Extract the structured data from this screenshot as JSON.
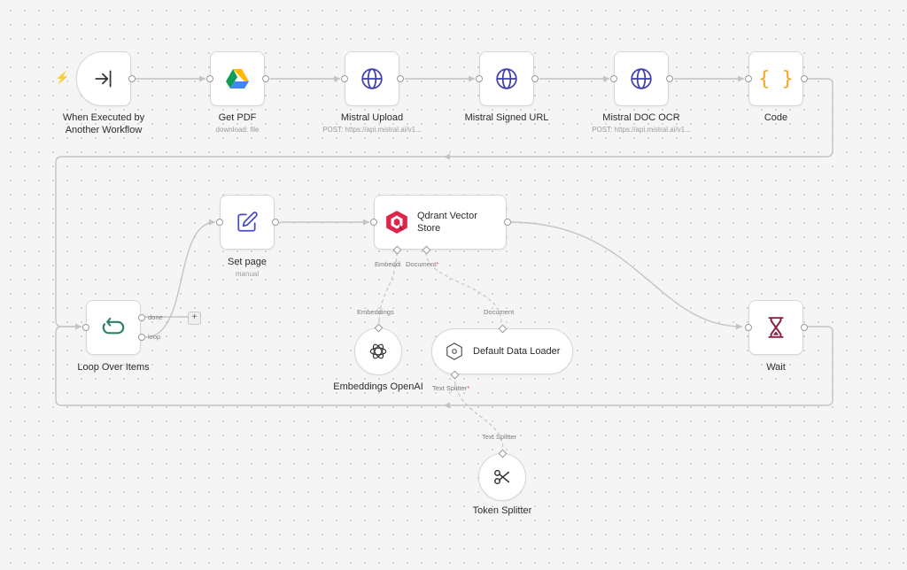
{
  "nodes": {
    "trigger": {
      "title": "When Executed by\nAnother Workflow",
      "icon": "enter-icon"
    },
    "get_pdf": {
      "title": "Get PDF",
      "subtitle": "download: file",
      "icon": "google-drive-icon"
    },
    "mistral_upload": {
      "title": "Mistral Upload",
      "subtitle": "POST: https://api.mistral.ai/v1...",
      "icon": "globe-icon"
    },
    "mistral_signed_url": {
      "title": "Mistral Signed URL",
      "icon": "globe-icon"
    },
    "mistral_doc_ocr": {
      "title": "Mistral DOC OCR",
      "subtitle": "POST: https://api.mistral.ai/v1...",
      "icon": "globe-icon"
    },
    "code": {
      "title": "Code",
      "icon": "curly-braces-icon"
    },
    "set_page": {
      "title": "Set page",
      "subtitle": "manual",
      "icon": "edit-icon"
    },
    "qdrant": {
      "title": "Qdrant Vector\nStore",
      "icon": "qdrant-icon",
      "port_labels": {
        "embedding": "Embeddi",
        "document": "Document"
      }
    },
    "loop": {
      "title": "Loop Over Items",
      "icon": "loop-icon",
      "outputs": {
        "done": "done",
        "loop": "loop"
      },
      "add": "+"
    },
    "embeddings": {
      "title": "Embeddings OpenAI",
      "icon": "openai-icon",
      "port_label": "Embeddings"
    },
    "data_loader": {
      "title": "Default Data Loader",
      "icon": "loader-icon",
      "port_label": "Document",
      "sub_port_label": "Text Splitter"
    },
    "wait": {
      "title": "Wait",
      "icon": "hourglass-icon"
    },
    "splitter": {
      "title": "Token Splitter",
      "icon": "scissors-icon",
      "port_label": "Text Splitter"
    }
  },
  "colors": {
    "canvas": "#f5f5f5",
    "wire": "#c4c4c4",
    "globe": "#3f3fb0",
    "code": "#f5a623",
    "edit": "#4a4ac4",
    "loop": "#2e7d6a",
    "wait": "#8a1f3d",
    "qdrant": "#dc244c",
    "trigger_bolt": "#f07e3a",
    "required": "#e2453a"
  }
}
